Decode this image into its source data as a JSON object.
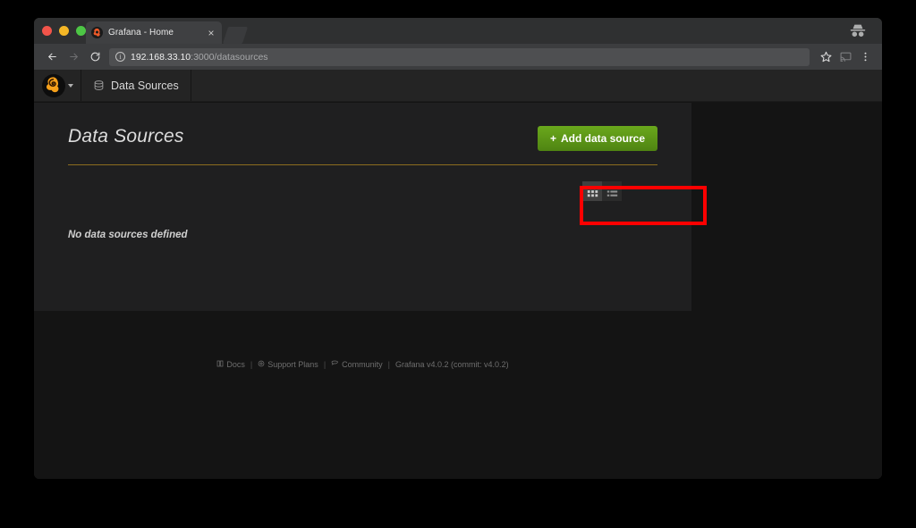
{
  "browser": {
    "tab": {
      "title": "Grafana - Home",
      "favicon_icon": "grafana-logo-icon",
      "close_icon": "close-icon"
    },
    "new_tab_icon": "new-tab-icon",
    "incognito_icon": "incognito-icon",
    "toolbar": {
      "back_icon": "back-arrow-icon",
      "forward_icon": "forward-arrow-icon",
      "reload_icon": "reload-icon",
      "info_icon": "info-icon",
      "url_host": "192.168.33.10",
      "url_path": ":3000/datasources",
      "bookmark_icon": "star-icon",
      "cast_icon": "cast-icon",
      "menu_icon": "three-dot-menu-icon"
    }
  },
  "grafana": {
    "navbar": {
      "logo_icon": "grafana-logo-icon",
      "caret_icon": "chevron-down-icon",
      "section_icon": "database-icon",
      "section_label": "Data Sources"
    },
    "page": {
      "title": "Data Sources",
      "add_button_label": "Add data source",
      "add_button_icon": "plus-icon",
      "add_button_color": "#5a9216",
      "grid_view_icon": "grid-view-icon",
      "list_view_icon": "list-view-icon",
      "empty_message": "No data sources defined"
    },
    "footer": {
      "docs_label": "Docs",
      "docs_icon": "book-icon",
      "support_label": "Support Plans",
      "support_icon": "gear-icon",
      "community_label": "Community",
      "community_icon": "comment-icon",
      "version_label": "Grafana v4.0.2 (commit: v4.0.2)",
      "separator": "|"
    }
  },
  "annotation": {
    "highlight_color": "#fe0000",
    "highlight_target": "add-data-source-button"
  }
}
